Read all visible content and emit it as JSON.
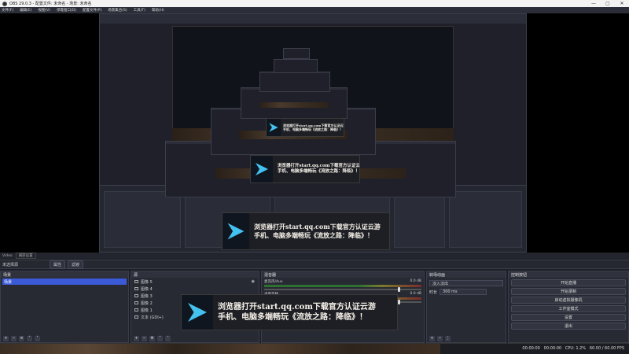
{
  "window": {
    "title": "OBS 29.0.3 - 配置文件: 未命名 - 场景: 未命名",
    "controls": [
      "—",
      "▢",
      "✕"
    ]
  },
  "menubar": [
    "文件(F)",
    "编辑(E)",
    "视图(V)",
    "停靠窗口(D)",
    "配置文件(P)",
    "场景集合(S)",
    "工具(T)",
    "帮助(H)"
  ],
  "ad": {
    "line1": "浏览器打开start.qq.com下载官方认证云游",
    "line2": "手机、电脑多端畅玩《流放之路：降临》！"
  },
  "statusline": {
    "label": "Video",
    "value": "捕获设置"
  },
  "toolbar2": {
    "label": "未选择源",
    "properties": "属性",
    "filters": "滤镜"
  },
  "scenes": {
    "header": "场景",
    "items": [
      "场景"
    ]
  },
  "sources": {
    "header": "源",
    "items": [
      "图像 5",
      "图像 4",
      "图像 3",
      "图像 2",
      "图像 1",
      "文本 (GDI+)"
    ]
  },
  "mixer": {
    "header": "混音器",
    "tracks": [
      {
        "name": "麦克风/Aux",
        "level": "0.0 dB"
      },
      {
        "name": "桌面音频",
        "level": "0.0 dB"
      }
    ]
  },
  "transitions": {
    "header": "转场动画",
    "type": "淡入淡出",
    "duration_label": "时长",
    "duration": "300 ms"
  },
  "controls": {
    "header": "控制按钮",
    "buttons": [
      "开始直播",
      "开始录制",
      "启动虚拟摄像机",
      "工作室模式",
      "设置",
      "退出"
    ]
  },
  "statusbar": {
    "live": "00:00:00",
    "rec": "00:00:00",
    "cpu": "CPU: 1.2%",
    "fps": "60.00 / 60.00 FPS"
  }
}
